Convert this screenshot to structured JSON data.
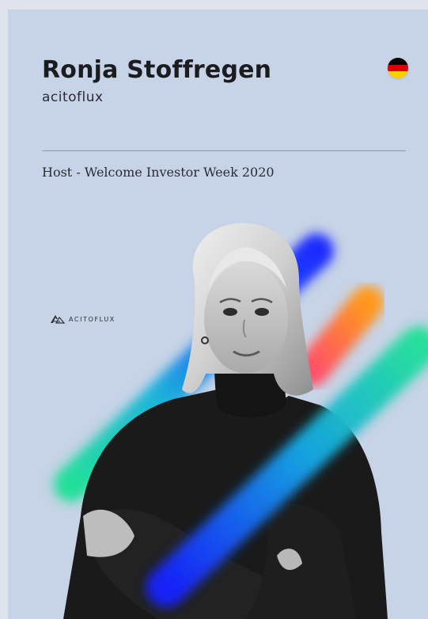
{
  "profile": {
    "name": "Ronja Stoffregen",
    "company": "acitoflux",
    "role": "Host - Welcome Investor Week 2020",
    "flag_icon": "germany-flag-icon"
  },
  "brand": {
    "logo_text": "ACITOFLUX",
    "logo_icon": "acitoflux-logo-icon"
  },
  "colors": {
    "card_background": "#c7d3e6",
    "text_dark": "#1b1c20",
    "stripe_blue": "#1f2cff",
    "stripe_orange": "#ff7a1a",
    "stripe_green": "#22e09a",
    "flag_black": "#000000",
    "flag_red": "#dd0000",
    "flag_gold": "#ffce00"
  }
}
